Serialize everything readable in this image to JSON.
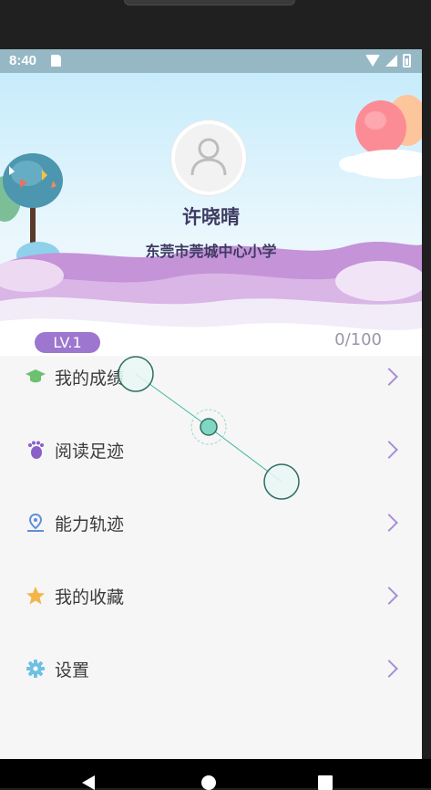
{
  "status_bar": {
    "time": "8:40"
  },
  "profile": {
    "name": "许晓晴",
    "school": "东莞市莞城中心小学",
    "level": "LV.1",
    "progress": "0/100"
  },
  "menu": {
    "items": [
      {
        "label": "我的成绩",
        "icon": "graduation-cap-icon",
        "color": "#6cc070"
      },
      {
        "label": "阅读足迹",
        "icon": "footprint-icon",
        "color": "#8a5fc8"
      },
      {
        "label": "能力轨迹",
        "icon": "location-pin-icon",
        "color": "#5f8fd8"
      },
      {
        "label": "我的收藏",
        "icon": "star-icon",
        "color": "#f4b447"
      },
      {
        "label": "设置",
        "icon": "gear-icon",
        "color": "#6ec1e4"
      }
    ]
  },
  "colors": {
    "accent": "#9d76cf",
    "status_bar": "#96b8c4",
    "header_sky": "#c7ecfb"
  }
}
